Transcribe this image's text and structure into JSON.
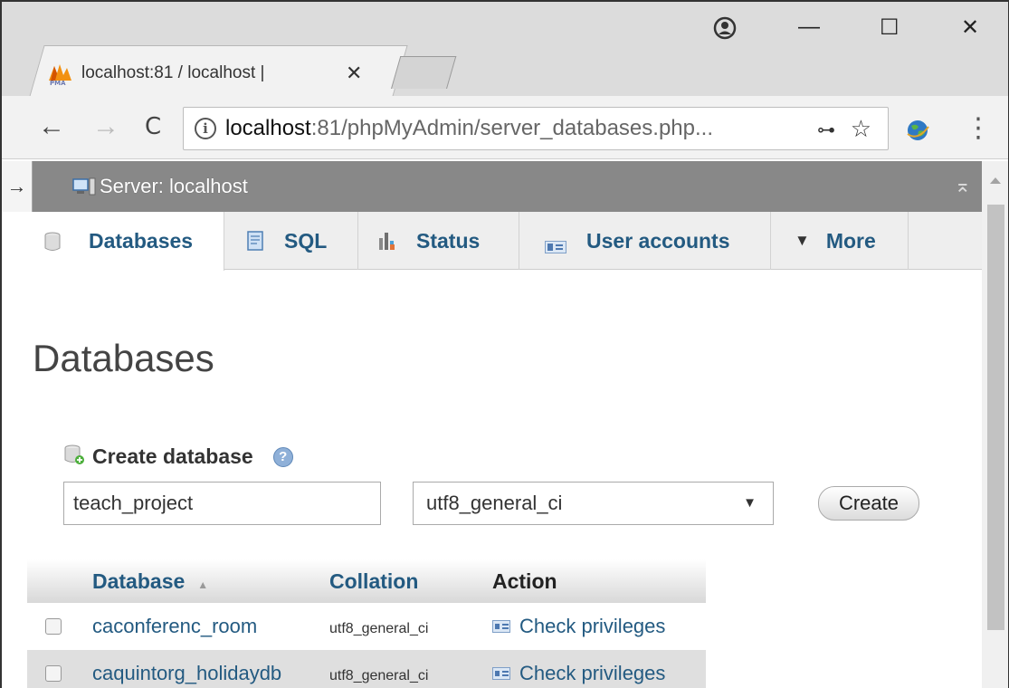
{
  "browser": {
    "tab_title": "localhost:81 / localhost | ",
    "tab_close": "✕",
    "url_host": "localhost",
    "url_rest": ":81/phpMyAdmin/server_databases.php...",
    "back": "←",
    "forward": "→",
    "reload": "C",
    "minimize": "—",
    "maximize": "☐",
    "close": "✕",
    "key_glyph": "⊶",
    "star_glyph": "☆",
    "menu_glyph": "⋮",
    "info_glyph": "i"
  },
  "server_bar": {
    "label": "Server: localhost",
    "collapse_glyph": "→",
    "top_glyph": "⌅"
  },
  "tabs": [
    {
      "label": "Databases"
    },
    {
      "label": "SQL"
    },
    {
      "label": "Status"
    },
    {
      "label": "User accounts"
    },
    {
      "label": "More",
      "prefix": "▼"
    }
  ],
  "page": {
    "title": "Databases",
    "create_label": "Create database",
    "help_glyph": "?",
    "db_name_value": "teach_project",
    "collation_value": "utf8_general_ci",
    "caret_glyph": "▼",
    "create_button": "Create"
  },
  "table": {
    "headers": {
      "database": "Database",
      "collation": "Collation",
      "action": "Action",
      "sort_glyph": "▲"
    },
    "rows": [
      {
        "name": "caconferenc_room",
        "collation": "utf8_general_ci",
        "action": "Check privileges"
      },
      {
        "name": "caquintorg_holidaydb",
        "collation": "utf8_general_ci",
        "action": "Check privileges"
      }
    ]
  }
}
